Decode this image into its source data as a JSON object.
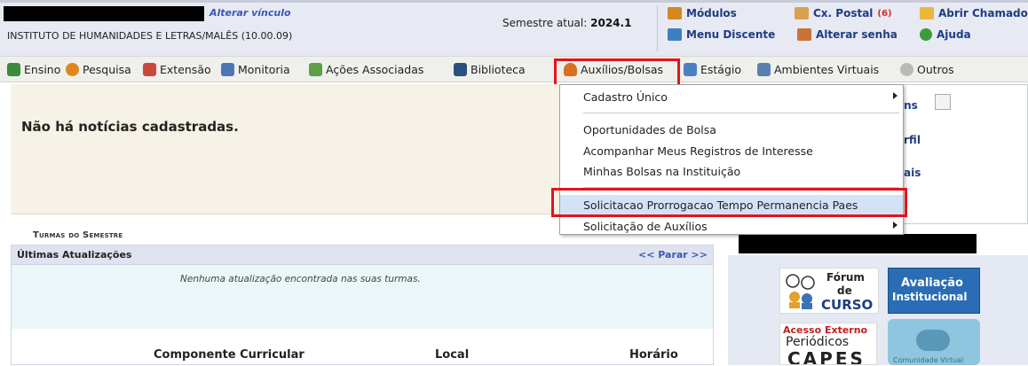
{
  "header": {
    "alterar_vinculo": "Alterar vínculo",
    "instituto": "INSTITUTO DE HUMANIDADES E LETRAS/MALÊS (10.00.09)",
    "semestre_label": "Semestre atual:",
    "semestre_value": "2024.1"
  },
  "quicklinks": {
    "modulos": "Módulos",
    "caixa_postal": "Cx. Postal",
    "caixa_postal_count": "(6)",
    "abrir_chamado": "Abrir Chamado",
    "menu_discente": "Menu Discente",
    "alterar_senha": "Alterar senha",
    "ajuda": "Ajuda"
  },
  "nav": {
    "items": [
      "Ensino",
      "Pesquisa",
      "Extensão",
      "Monitoria",
      "Ações Associadas",
      "Biblioteca",
      "Auxílios/Bolsas",
      "Estágio",
      "Ambientes Virtuais",
      "Outros"
    ]
  },
  "dropdown": {
    "items": [
      "Cadastro Único",
      "Oportunidades de Bolsa",
      "Acompanhar Meus Registros de Interesse",
      "Minhas Bolsas na Instituição",
      "Solicitacao Prorrogacao Tempo Permanencia Paes",
      "Solicitação de Auxílios"
    ]
  },
  "news": {
    "empty": "Não há notícias cadastradas."
  },
  "turmas": {
    "title": "Turmas do Semestre",
    "ultimas_title": "Últimas Atualizações",
    "parar": "<< Parar >>",
    "empty": "Nenhuma atualização encontrada nas suas turmas.",
    "col_componente": "Componente Curricular",
    "col_local": "Local",
    "col_horario": "Horário"
  },
  "right_panel": {
    "link_1": "ens",
    "link_2": "rfil",
    "link_3": "ais",
    "forum_1": "Fórum",
    "forum_2": "de",
    "forum_3": "CURSO",
    "aval_1": "Avaliação",
    "aval_2": "Institucional",
    "capes_1": "Acesso Externo",
    "capes_2": "Periódicos",
    "capes_3": "CAPES",
    "comm_label": "Comunidade Virtual"
  },
  "colors": {
    "highlight": "#e4141b",
    "link": "#1f3c82",
    "badge": "#d42c2c"
  }
}
